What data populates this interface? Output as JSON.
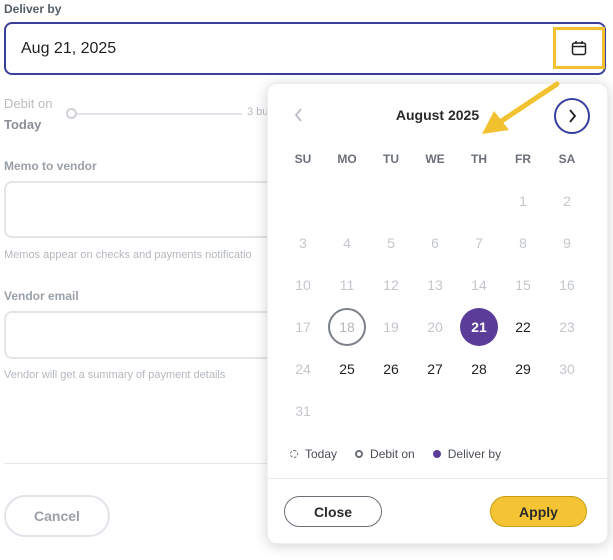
{
  "form": {
    "deliver_by_label": "Deliver by",
    "deliver_by_value": "Aug 21, 2025",
    "debit_on_label": "Debit on",
    "debit_on_value": "Today",
    "timeline_end": "3 bu",
    "memo_label": "Memo to vendor",
    "memo_hint": "Memos appear on checks and payments notificatio",
    "email_label": "Vendor email",
    "email_hint": "Vendor will get a summary of payment details",
    "cancel_label": "Cancel"
  },
  "calendar": {
    "month_title": "August 2025",
    "weekdays": [
      "SU",
      "MO",
      "TU",
      "WE",
      "TH",
      "FR",
      "SA"
    ],
    "weeks": [
      [
        null,
        null,
        null,
        null,
        null,
        "1",
        "2"
      ],
      [
        "3",
        "4",
        "5",
        "6",
        "7",
        "8",
        "9"
      ],
      [
        "10",
        "11",
        "12",
        "13",
        "14",
        "15",
        "16"
      ],
      [
        "17",
        "18",
        "19",
        "20",
        "21",
        "22",
        "23"
      ],
      [
        "24",
        "25",
        "26",
        "27",
        "28",
        "29",
        "30"
      ],
      [
        "31",
        null,
        null,
        null,
        null,
        null,
        null
      ]
    ],
    "today": "18",
    "debit_on": "18",
    "deliver_by": "21",
    "selectable": [
      "22",
      "25",
      "26",
      "27",
      "28",
      "29"
    ],
    "legend": {
      "today": "Today",
      "debit_on": "Debit on",
      "deliver_by": "Deliver by"
    },
    "close_label": "Close",
    "apply_label": "Apply"
  },
  "icons": {
    "calendar_button": "calendar-icon",
    "prev": "chevron-left-icon",
    "next": "chevron-right-icon"
  },
  "colors": {
    "focus_border": "#3b3f9a",
    "deliver_fill": "#5b3c98",
    "apply_fill": "#f5c434",
    "highlight": "#f2c130"
  }
}
